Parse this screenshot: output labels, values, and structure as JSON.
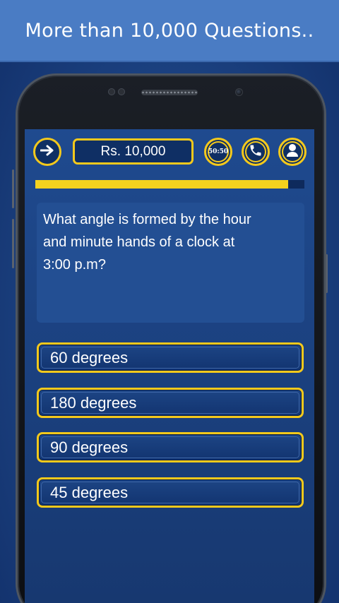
{
  "banner": {
    "title": "More than 10,000 Questions.."
  },
  "toolbar": {
    "prize_label": "Rs. 10,000",
    "fifty_fifty_label": "50:50",
    "icons": [
      "arrow-right-icon",
      "phone-icon",
      "person-icon"
    ]
  },
  "progress": {
    "fraction": 0.94
  },
  "question": {
    "text_line1": "What angle is formed by the hour",
    "text_line2": "and minute hands of a clock at",
    "text_line3": "3:00 p.m?"
  },
  "answers": [
    {
      "label": "60 degrees"
    },
    {
      "label": "180 degrees"
    },
    {
      "label": "90 degrees"
    },
    {
      "label": "45 degrees"
    }
  ],
  "colors": {
    "accent_gold": "#f4c91c",
    "banner_blue": "#4a7cc4",
    "screen_blue": "#1f4a8f"
  }
}
